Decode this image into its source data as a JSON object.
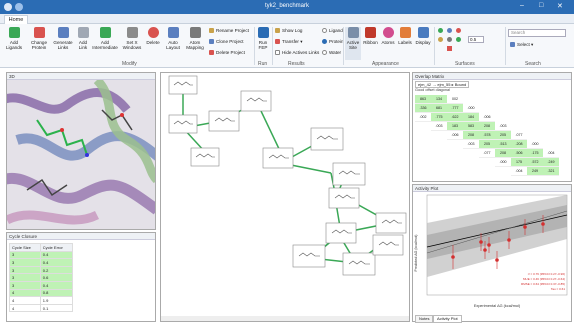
{
  "window": {
    "title": "tyk2_benchmark",
    "min": "–",
    "max": "□",
    "close": "✕"
  },
  "tabs": [
    "Home"
  ],
  "ribbon": {
    "buttons": [
      {
        "label": "Add Ligands",
        "color": "#3aa856"
      },
      {
        "label": "Change Protein",
        "color": "#d9534f"
      },
      {
        "label": "Generate Links",
        "color": "#5b7fbf"
      },
      {
        "label": "Add Link",
        "color": "#a0a8b4"
      },
      {
        "label": "Add Intermediate",
        "color": "#3aa856"
      },
      {
        "label": "Set X Windows",
        "color": "#8b8b8b"
      },
      {
        "label": "Delete",
        "color": "#d9534f"
      },
      {
        "label": "Auto Layout",
        "color": "#5b7fbf"
      },
      {
        "label": "Atom Mapping",
        "color": "#7a7a7a"
      }
    ],
    "project_items": [
      "Rename Project",
      "Clone Project",
      "Delete Project"
    ],
    "run_label": "Run FEP",
    "results_items": [
      "Show Log",
      "Transfer",
      "Hide Actives Links"
    ],
    "radio_items": [
      "Ligand",
      "Protein",
      "Water"
    ],
    "appearance_buttons": [
      "Active Site",
      "Ribbon",
      "Atoms",
      "Labels",
      "Display"
    ],
    "surface_value": "0.5",
    "search_placeholder": "Search",
    "select_label": "Select",
    "groups": [
      "Modify",
      "Run",
      "Results",
      "Appearance",
      "Surfaces",
      "Search"
    ]
  },
  "panels": {
    "viewer_title": "3D",
    "cycles_title": "Cycle Closure",
    "network_title": "",
    "matrix_title": "Overlap Matrix",
    "matrix_subtitle": "ejm_42 → ejm_55 ▸ Bound",
    "matrix_note": "Good offset diagonal",
    "plot_title": "Activity Plot"
  },
  "cycles": {
    "headers": [
      "Cycle Size",
      "Cycle Error"
    ],
    "rows": [
      {
        "size": "3",
        "err": "0.4"
      },
      {
        "size": "3",
        "err": "0.4"
      },
      {
        "size": "3",
        "err": "0.2"
      },
      {
        "size": "3",
        "err": "0.6"
      },
      {
        "size": "3",
        "err": "0.4"
      },
      {
        "size": "4",
        "err": "0.8"
      },
      {
        "size": "4",
        "err": "1.9"
      },
      {
        "size": "4",
        "err": "0.1"
      }
    ]
  },
  "matrix": {
    "rows": [
      [
        "863",
        "134",
        "002"
      ],
      [
        ".336",
        "681",
        ".777",
        ".000"
      ],
      [
        ".002",
        ".775",
        ".622",
        "184",
        ".006"
      ],
      [
        "",
        ".003",
        "183",
        "583",
        "208",
        ".003"
      ],
      [
        "",
        "",
        ".006",
        "208",
        ".578",
        "205",
        ".077"
      ],
      [
        "",
        "",
        "",
        ".003",
        "205",
        ".513",
        ".208",
        ".000"
      ],
      [
        "",
        "",
        "",
        "",
        ".077",
        "208",
        ".506",
        ".175",
        ".004"
      ],
      [
        "",
        "",
        "",
        "",
        "",
        ".000",
        "175",
        ".572",
        ".249"
      ],
      [
        "",
        "",
        "",
        "",
        "",
        "",
        ".004",
        "249",
        ".321"
      ]
    ]
  },
  "plot": {
    "ylabel": "Predicted ΔG (kcal/mol)",
    "xlabel": "Experimental ΔG (kcal/mol)",
    "stats": [
      "r² = 0.76 (95%CI 0.27–0.96)",
      "MUE = 0.46 (95%CI 0.27–0.64)",
      "RMSE = 0.64 (95%CI 0.37–0.85)",
      "Tau = 0.61"
    ],
    "tabs": [
      "Notes",
      "Activity Plot"
    ]
  },
  "nodes_count_text": ""
}
